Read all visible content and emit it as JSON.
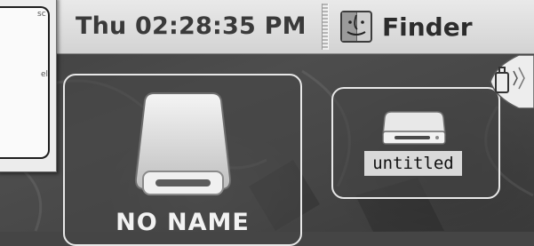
{
  "menubar": {
    "clock": "Thu 02:28:35 PM",
    "app_name": "Finder",
    "app_icon": "finder-icon"
  },
  "window": {
    "fragment_top": "sc",
    "fragment_mid": "el"
  },
  "desktop": {
    "volumes": [
      {
        "label": "NO NAME",
        "icon": "removable-disk-icon"
      },
      {
        "label": "untitled",
        "icon": "hard-drive-icon"
      }
    ]
  },
  "colors": {
    "menubar": "#dcdcdc",
    "desktop": "#454545",
    "selection_outline": "#e8e8e8"
  }
}
